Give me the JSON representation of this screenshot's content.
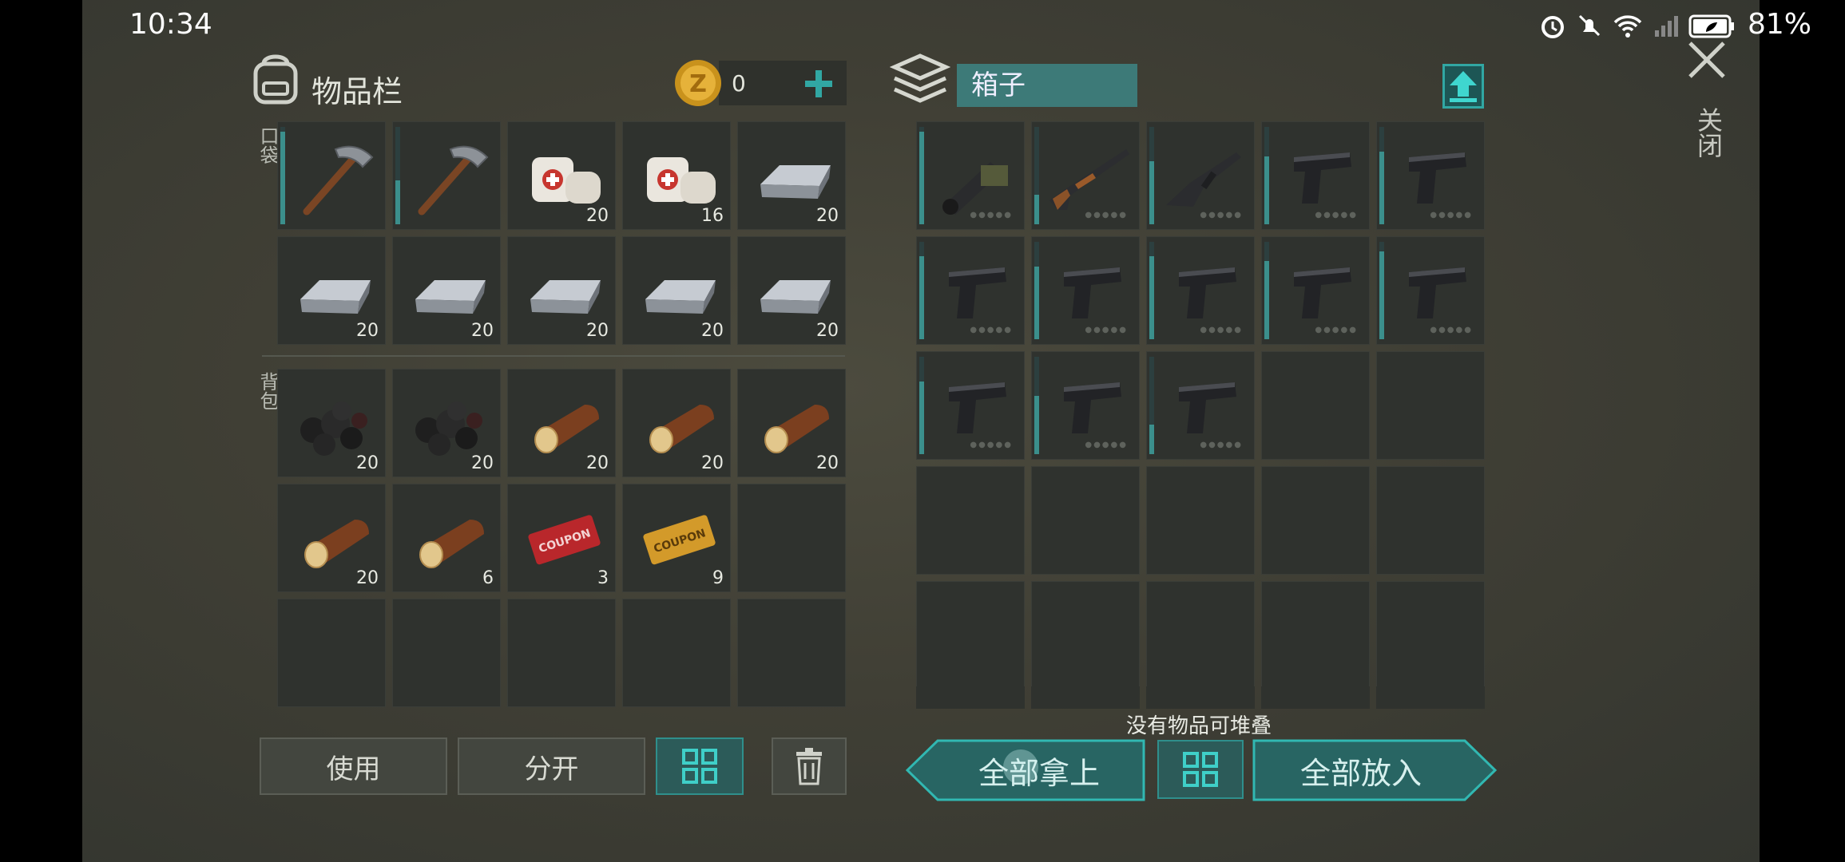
{
  "status_bar": {
    "time": "10:34",
    "battery": "81%"
  },
  "inventory": {
    "title": "物品栏",
    "coins": "0",
    "pockets_label": "口袋",
    "backpack_label": "背包",
    "pocket_slots": [
      {
        "item": "pickaxe-icon",
        "qty": "",
        "durability": 0.95
      },
      {
        "item": "pickaxe-icon",
        "qty": "",
        "durability": 0.45
      },
      {
        "item": "bandage-icon",
        "qty": "20"
      },
      {
        "item": "bandage-icon",
        "qty": "16"
      },
      {
        "item": "iron-ingot-icon",
        "qty": "20"
      },
      {
        "item": "iron-ingot-icon",
        "qty": "20"
      },
      {
        "item": "iron-ingot-icon",
        "qty": "20"
      },
      {
        "item": "iron-ingot-icon",
        "qty": "20"
      },
      {
        "item": "iron-ingot-icon",
        "qty": "20"
      },
      {
        "item": "iron-ingot-icon",
        "qty": "20"
      }
    ],
    "backpack_slots": [
      {
        "item": "coal-icon",
        "qty": "20"
      },
      {
        "item": "coal-icon",
        "qty": "20"
      },
      {
        "item": "log-icon",
        "qty": "20"
      },
      {
        "item": "log-icon",
        "qty": "20"
      },
      {
        "item": "log-icon",
        "qty": "20"
      },
      {
        "item": "log-icon",
        "qty": "20"
      },
      {
        "item": "log-icon",
        "qty": "6"
      },
      {
        "item": "red-coupon-icon",
        "qty": "3"
      },
      {
        "item": "gold-coupon-icon",
        "qty": "9"
      },
      {
        "item": "",
        "qty": ""
      },
      {
        "item": "",
        "qty": ""
      },
      {
        "item": "",
        "qty": ""
      },
      {
        "item": "",
        "qty": ""
      },
      {
        "item": "",
        "qty": ""
      },
      {
        "item": "",
        "qty": ""
      }
    ],
    "buttons": {
      "use": "使用",
      "split": "分开"
    }
  },
  "container": {
    "name": "箱子",
    "hint": "没有物品可堆叠",
    "take_all": "全部拿上",
    "put_all": "全部放入",
    "close": "关闭",
    "slots": [
      {
        "item": "grenade-launcher-icon",
        "durability": 0.95
      },
      {
        "item": "shotgun-icon",
        "durability": 0.3
      },
      {
        "item": "rifle-icon",
        "durability": 0.65
      },
      {
        "item": "pistol-icon",
        "durability": 0.7
      },
      {
        "item": "pistol-icon",
        "durability": 0.75
      },
      {
        "item": "pistol-icon",
        "durability": 0.85
      },
      {
        "item": "pistol-icon",
        "durability": 0.75
      },
      {
        "item": "pistol-icon",
        "durability": 0.85
      },
      {
        "item": "pistol-icon",
        "durability": 0.8
      },
      {
        "item": "pistol-icon",
        "durability": 0.9
      },
      {
        "item": "pistol-icon",
        "durability": 0.75
      },
      {
        "item": "pistol-icon",
        "durability": 0.6
      },
      {
        "item": "pistol-icon",
        "durability": 0.3
      },
      {
        "item": ""
      },
      {
        "item": ""
      },
      {
        "item": ""
      },
      {
        "item": ""
      },
      {
        "item": ""
      },
      {
        "item": ""
      },
      {
        "item": ""
      },
      {
        "item": ""
      },
      {
        "item": ""
      },
      {
        "item": ""
      },
      {
        "item": ""
      },
      {
        "item": ""
      }
    ]
  }
}
